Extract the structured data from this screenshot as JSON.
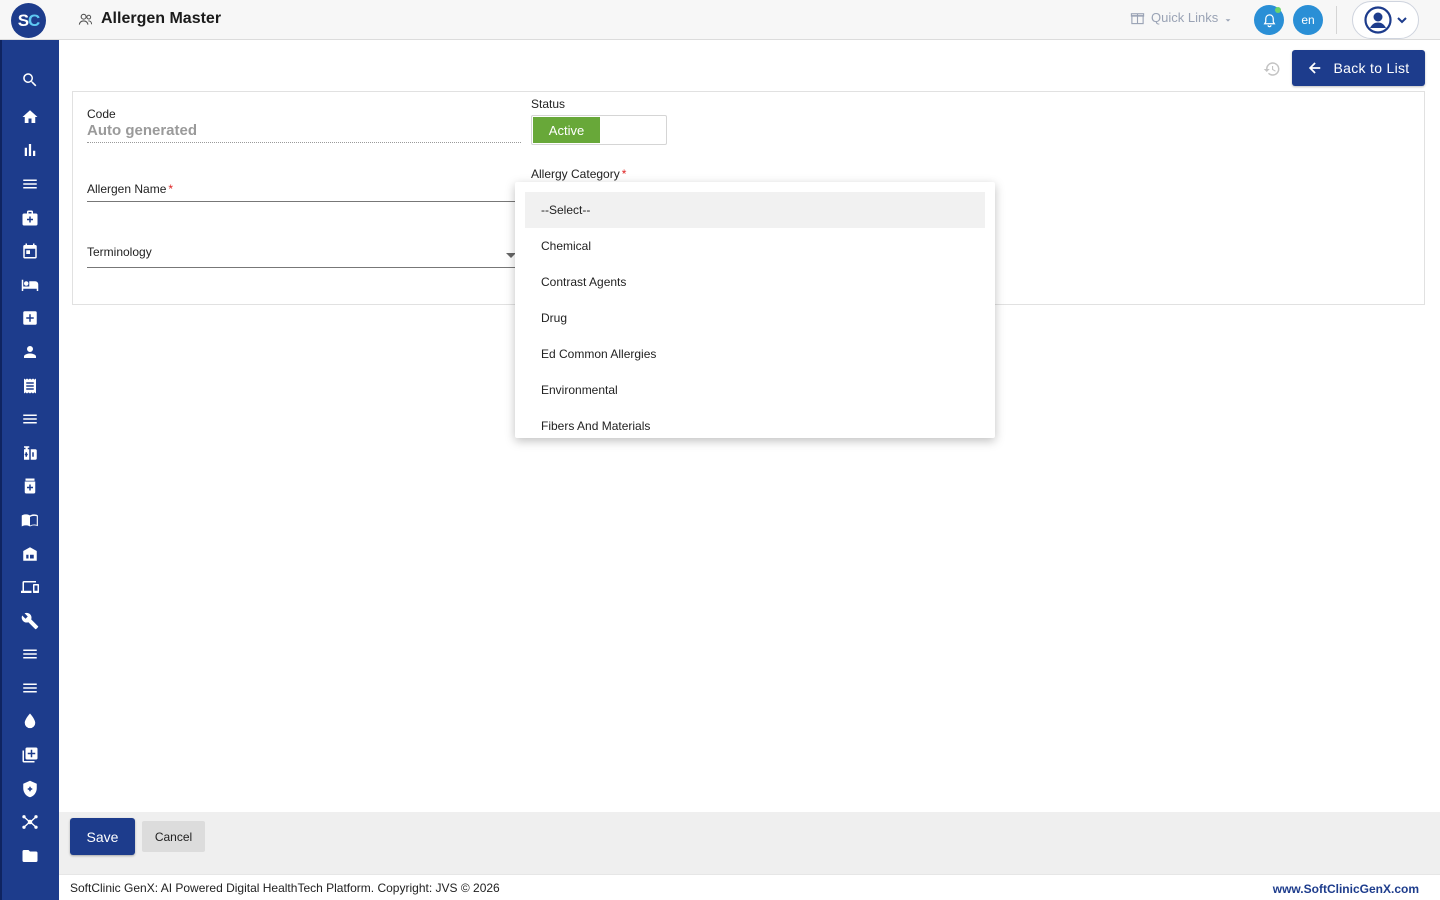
{
  "header": {
    "logo_s": "S",
    "logo_c": "C",
    "title": "Allergen Master",
    "quick_links": "Quick Links",
    "lang": "en"
  },
  "sidebar": {
    "icons": [
      "search-icon",
      "home-icon",
      "bar-chart-icon",
      "menu-icon",
      "medical-bag-icon",
      "calendar-icon",
      "bed-icon",
      "medical-cross-icon",
      "person-icon",
      "receipt-icon",
      "menu-icon",
      "pharmacy-icon",
      "medicine-bottle-icon",
      "book-icon",
      "store-icon",
      "devices-icon",
      "wrench-icon",
      "menu-icon",
      "menu-icon",
      "blood-drop-icon",
      "add-library-icon",
      "shield-icon",
      "network-icon",
      "folder-icon"
    ]
  },
  "toolbar": {
    "back_label": "Back to List"
  },
  "form": {
    "code_label": "Code",
    "code_value": "Auto generated",
    "status_label": "Status",
    "status_value": "Active",
    "allergen_name_label": "Allergen Name",
    "allergy_category_label": "Allergy Category",
    "terminology_label": "Terminology",
    "required_mark": "*"
  },
  "dropdown": {
    "options": [
      "--Select--",
      "Chemical",
      "Contrast Agents",
      "Drug",
      "Ed Common Allergies",
      "Environmental",
      "Fibers And Materials"
    ]
  },
  "actions": {
    "save_label": "Save",
    "cancel_label": "Cancel"
  },
  "footer": {
    "copyright": "SoftClinic GenX: AI Powered Digital HealthTech Platform. Copyright: JVS © 2026",
    "site": "www.SoftClinicGenX.com"
  },
  "colors": {
    "brand": "#1d3c8c",
    "active_green": "#68a839",
    "accent_blue": "#2a8fd6"
  }
}
